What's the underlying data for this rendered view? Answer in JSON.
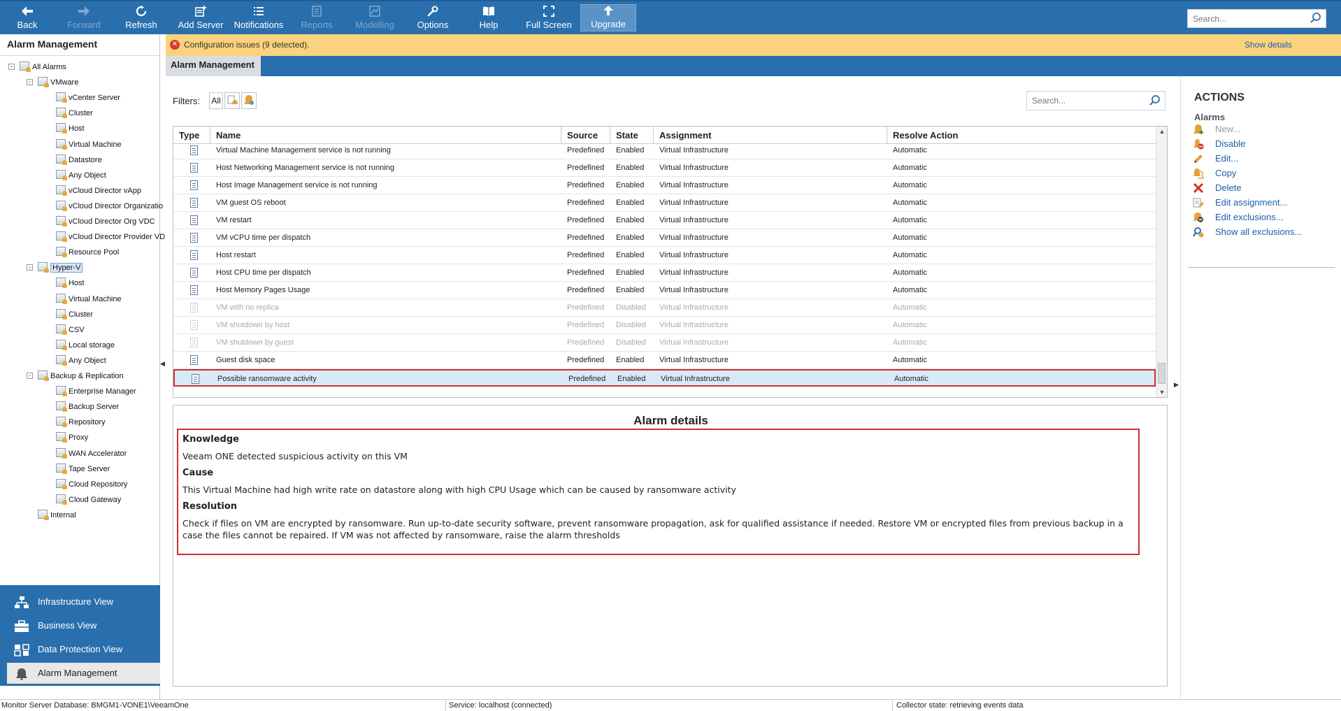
{
  "toolbar": {
    "buttons": [
      {
        "label": "Back",
        "icon": "arrow-left-icon",
        "enabled": true
      },
      {
        "label": "Forward",
        "icon": "arrow-right-icon",
        "enabled": false
      },
      {
        "label": "Refresh",
        "icon": "refresh-icon",
        "enabled": true
      },
      {
        "label": "Add Server",
        "icon": "add-server-icon",
        "enabled": true
      },
      {
        "label": "Notifications",
        "icon": "list-icon",
        "enabled": true
      },
      {
        "label": "Reports",
        "icon": "report-icon",
        "enabled": false
      },
      {
        "label": "Modelling",
        "icon": "modelling-icon",
        "enabled": false
      },
      {
        "label": "Options",
        "icon": "wrench-icon",
        "enabled": true
      },
      {
        "label": "Help",
        "icon": "book-icon",
        "enabled": true
      },
      {
        "label": "Full Screen",
        "icon": "fullscreen-icon",
        "enabled": true
      },
      {
        "label": "Upgrade",
        "icon": "arrow-up-icon",
        "enabled": true
      }
    ],
    "search_placeholder": "Search..."
  },
  "left_panel": {
    "title": "Alarm Management",
    "tree": [
      {
        "label": "All Alarms",
        "level": 0,
        "expander": "-"
      },
      {
        "label": "VMware",
        "level": 1,
        "expander": "-"
      },
      {
        "label": "vCenter Server",
        "level": 2
      },
      {
        "label": "Cluster",
        "level": 2
      },
      {
        "label": "Host",
        "level": 2
      },
      {
        "label": "Virtual Machine",
        "level": 2
      },
      {
        "label": "Datastore",
        "level": 2
      },
      {
        "label": "Any Object",
        "level": 2
      },
      {
        "label": "vCloud Director vApp",
        "level": 2
      },
      {
        "label": "vCloud Director Organizatio",
        "level": 2
      },
      {
        "label": "vCloud Director Org VDC",
        "level": 2
      },
      {
        "label": "vCloud Director Provider VD",
        "level": 2
      },
      {
        "label": "Resource Pool",
        "level": 2
      },
      {
        "label": "Hyper-V",
        "level": 1,
        "expander": "-",
        "selected": true
      },
      {
        "label": "Host",
        "level": 2
      },
      {
        "label": "Virtual Machine",
        "level": 2
      },
      {
        "label": "Cluster",
        "level": 2
      },
      {
        "label": "CSV",
        "level": 2
      },
      {
        "label": "Local storage",
        "level": 2
      },
      {
        "label": "Any Object",
        "level": 2
      },
      {
        "label": "Backup & Replication",
        "level": 1,
        "expander": "-"
      },
      {
        "label": "Enterprise Manager",
        "level": 2
      },
      {
        "label": "Backup Server",
        "level": 2
      },
      {
        "label": "Repository",
        "level": 2
      },
      {
        "label": "Proxy",
        "level": 2
      },
      {
        "label": "WAN Accelerator",
        "level": 2
      },
      {
        "label": "Tape Server",
        "level": 2
      },
      {
        "label": "Cloud Repository",
        "level": 2
      },
      {
        "label": "Cloud Gateway",
        "level": 2
      },
      {
        "label": "Internal",
        "level": 1
      }
    ]
  },
  "nav": {
    "items": [
      {
        "label": "Infrastructure View",
        "icon": "infrastructure-icon",
        "active": false
      },
      {
        "label": "Business View",
        "icon": "business-icon",
        "active": false
      },
      {
        "label": "Data Protection View",
        "icon": "data-protection-icon",
        "active": false
      },
      {
        "label": "Alarm Management",
        "icon": "bell-icon",
        "active": true
      }
    ]
  },
  "config_bar": {
    "message": "Configuration issues (9 detected).",
    "link": "Show details",
    "color": "#fbd27d"
  },
  "header": {
    "tab": "Alarm Management"
  },
  "filters": {
    "label": "Filters:",
    "all_label": "All",
    "search_placeholder": "Search..."
  },
  "grid": {
    "columns": [
      "Type",
      "Name",
      "Source",
      "State",
      "Assignment",
      "Resolve Action"
    ],
    "rows": [
      {
        "name": "Virtual Machine Management service is not running",
        "source": "Predefined",
        "state": "Enabled",
        "assignment": "Virtual Infrastructure",
        "resolve": "Automatic"
      },
      {
        "name": "Host Networking Management service is not running",
        "source": "Predefined",
        "state": "Enabled",
        "assignment": "Virtual Infrastructure",
        "resolve": "Automatic"
      },
      {
        "name": "Host Image Management service is not running",
        "source": "Predefined",
        "state": "Enabled",
        "assignment": "Virtual Infrastructure",
        "resolve": "Automatic"
      },
      {
        "name": "VM guest OS reboot",
        "source": "Predefined",
        "state": "Enabled",
        "assignment": "Virtual Infrastructure",
        "resolve": "Automatic"
      },
      {
        "name": "VM restart",
        "source": "Predefined",
        "state": "Enabled",
        "assignment": "Virtual Infrastructure",
        "resolve": "Automatic"
      },
      {
        "name": "VM vCPU time per dispatch",
        "source": "Predefined",
        "state": "Enabled",
        "assignment": "Virtual Infrastructure",
        "resolve": "Automatic"
      },
      {
        "name": "Host restart",
        "source": "Predefined",
        "state": "Enabled",
        "assignment": "Virtual Infrastructure",
        "resolve": "Automatic"
      },
      {
        "name": "Host CPU time per dispatch",
        "source": "Predefined",
        "state": "Enabled",
        "assignment": "Virtual Infrastructure",
        "resolve": "Automatic"
      },
      {
        "name": "Host Memory Pages Usage",
        "source": "Predefined",
        "state": "Enabled",
        "assignment": "Virtual Infrastructure",
        "resolve": "Automatic"
      },
      {
        "name": "VM with no replica",
        "source": "Predefined",
        "state": "Disabled",
        "assignment": "Virtual Infrastructure",
        "resolve": "Automatic",
        "disabled": true
      },
      {
        "name": "VM shutdown by host",
        "source": "Predefined",
        "state": "Disabled",
        "assignment": "Virtual Infrastructure",
        "resolve": "Automatic",
        "disabled": true
      },
      {
        "name": "VM shutdown by guest",
        "source": "Predefined",
        "state": "Disabled",
        "assignment": "Virtual Infrastructure",
        "resolve": "Automatic",
        "disabled": true
      },
      {
        "name": "Guest disk space",
        "source": "Predefined",
        "state": "Enabled",
        "assignment": "Virtual Infrastructure",
        "resolve": "Automatic"
      },
      {
        "name": "Possible ransomware activity",
        "source": "Predefined",
        "state": "Enabled",
        "assignment": "Virtual Infrastructure",
        "resolve": "Automatic",
        "selected": true
      }
    ]
  },
  "details": {
    "title": "Alarm details",
    "knowledge_heading": "Knowledge",
    "knowledge": "Veeam ONE detected suspicious activity on this VM",
    "cause_heading": "Cause",
    "cause": "This Virtual Machine had high write rate on datastore along with high CPU Usage which can be caused by ransomware activity",
    "resolution_heading": "Resolution",
    "resolution": "Check if files on VM are encrypted by ransomware. Run up-to-date security software, prevent ransomware propagation, ask for qualified assistance if needed. Restore VM or encrypted files from previous backup in a case the files cannot be repaired. If VM was not affected by ransomware, raise the alarm thresholds"
  },
  "actions": {
    "title": "ACTIONS",
    "subtitle": "Alarms",
    "items": [
      {
        "label": "New...",
        "icon": "new-alarm-icon",
        "enabled": false
      },
      {
        "label": "Disable",
        "icon": "disable-icon",
        "enabled": true
      },
      {
        "label": "Edit...",
        "icon": "pencil-icon",
        "enabled": true
      },
      {
        "label": "Copy",
        "icon": "copy-icon",
        "enabled": true
      },
      {
        "label": "Delete",
        "icon": "delete-icon",
        "enabled": true
      },
      {
        "label": "Edit assignment...",
        "icon": "assignment-icon",
        "enabled": true
      },
      {
        "label": "Edit exclusions...",
        "icon": "exclusions-icon",
        "enabled": true
      },
      {
        "label": "Show all exclusions...",
        "icon": "show-exclusions-icon",
        "enabled": true
      }
    ]
  },
  "status": {
    "database": "Monitor Server Database: BMGM1-VONE1\\VeeamOne",
    "service": "Service: localhost (connected)",
    "collector": "Collector state:  retrieving events data"
  },
  "colors": {
    "accent": "#2a6fad",
    "highlight": "#d12f2f",
    "selection": "#d8eaf7"
  }
}
